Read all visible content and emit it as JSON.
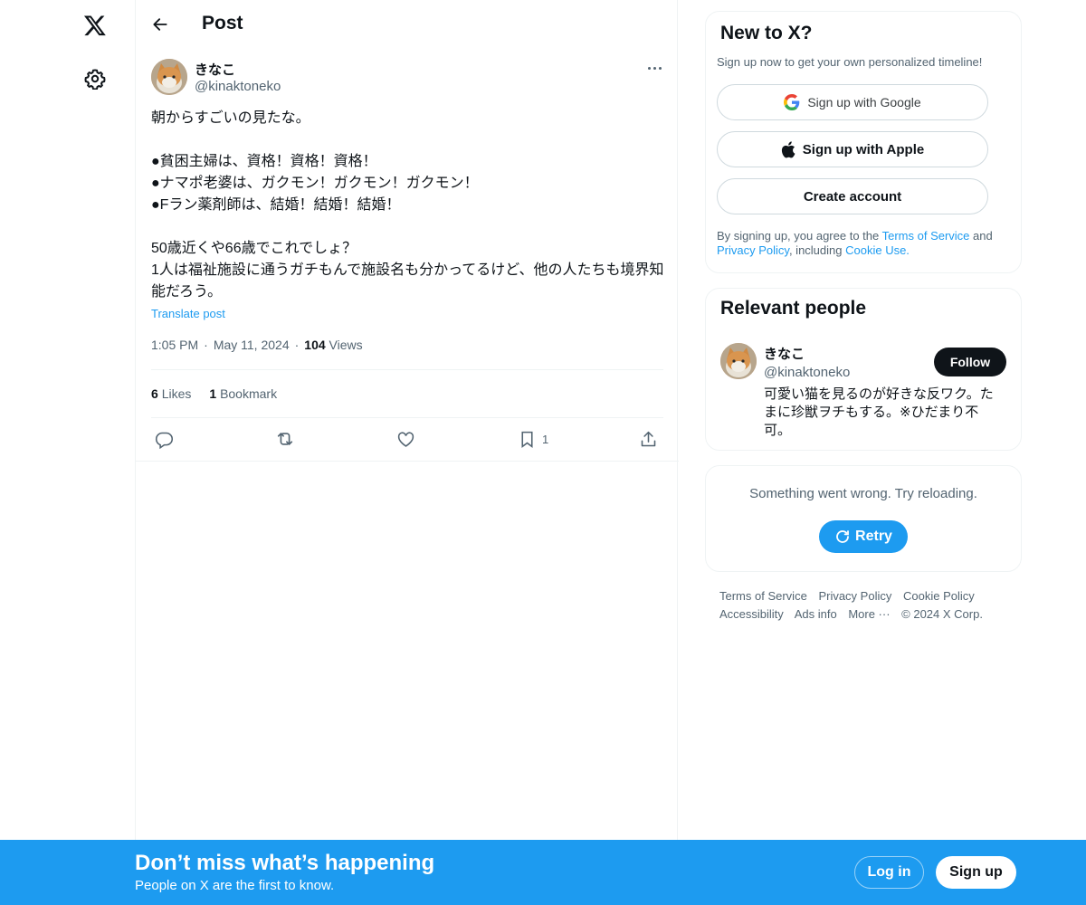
{
  "colors": {
    "accent": "#1d9bf0",
    "text": "#0f1419",
    "muted": "#536471",
    "border": "#eff3f4"
  },
  "nav": {
    "logo_icon": "x-logo-icon",
    "settings_icon": "gear-icon"
  },
  "header": {
    "title": "Post",
    "back_icon": "arrow-left-icon"
  },
  "post": {
    "author_name": "きなこ",
    "author_handle": "@kinaktoneko",
    "text": "朝からすごいの見たな。\n\n●貧困主婦は、資格！資格！資格！\n●ナマポ老婆は、ガクモン！ガクモン！ガクモン！\n●Fラン薬剤師は、結婚！結婚！結婚！\n\n50歳近くや66歳でこれでしょ？\n1人は福祉施設に通うガチもんで施設名も分かってるけど、他の人たちも境界知能だろう。",
    "translate": "Translate post",
    "time": "1:05 PM",
    "sep": "·",
    "date": "May 11, 2024",
    "views_count": "104",
    "views_label": "Views",
    "likes_count": "6",
    "likes_label": "Likes",
    "bookmarks_count": "1",
    "bookmarks_label": "Bookmark",
    "bookmark_action_count": "1"
  },
  "signup_card": {
    "title": "New to X?",
    "subtitle": "Sign up now to get your own personalized timeline!",
    "google_label": "Sign up with Google",
    "apple_label": "Sign up with Apple",
    "create_label": "Create account",
    "legal_prefix": "By signing up, you agree to the ",
    "terms_link": "Terms of Service",
    "legal_and": " and ",
    "privacy_link": "Privacy Policy",
    "legal_including": ", including ",
    "cookie_link": "Cookie Use."
  },
  "relevant": {
    "title": "Relevant people",
    "name": "きなこ",
    "handle": "@kinaktoneko",
    "follow_label": "Follow",
    "bio": "可愛い猫を見るのが好きな反ワク。たまに珍獣ヲチもする。※ひだまり不可。"
  },
  "error_card": {
    "message": "Something went wrong. Try reloading.",
    "retry_label": "Retry"
  },
  "footer": {
    "links": [
      "Terms of Service",
      "Privacy Policy",
      "Cookie Policy",
      "Accessibility",
      "Ads info",
      "More ···"
    ],
    "copyright": "© 2024 X Corp."
  },
  "banner": {
    "title": "Don’t miss what’s happening",
    "subtitle": "People on X are the first to know.",
    "login_label": "Log in",
    "signup_label": "Sign up"
  }
}
